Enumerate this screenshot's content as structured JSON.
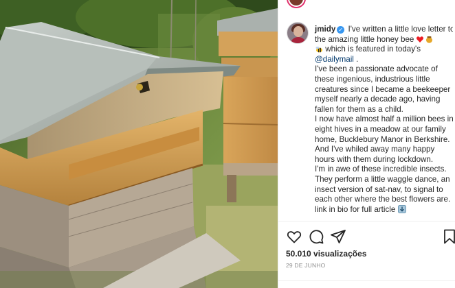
{
  "post": {
    "username": "jmidy",
    "caption_intro_a": " I've written a little love letter to the amazing little honey bee ",
    "caption_intro_b": " which is featured in today's ",
    "mention": "@dailymail",
    "mention_after": " .",
    "paragraph_1": "I've been a passionate advocate of these ingenious, industrious little creatures since I became a beekeeper myself nearly a decade ago, having fallen for them as a child.",
    "paragraph_2": "I now have almost half a million bees in eight hives in a meadow at our family home, Bucklebury Manor in Berkshire. And I've whiled away many happy hours with them during lockdown.",
    "paragraph_3": "I'm in awe of these incredible insects. They perform a little waggle dance, an insect version of sat-nav, to signal to each other where the best flowers are.",
    "link_text": "link in bio for full article",
    "views": "50.010 visualizações",
    "date": "29 DE JUNHO"
  },
  "icons": {
    "verified": "verified-badge-icon",
    "like": "heart-icon",
    "comment": "comment-bubble-icon",
    "share": "paper-plane-icon",
    "save": "bookmark-icon",
    "heart_emoji": "red-heart-emoji",
    "honey_emoji": "honey-pot-emoji",
    "bee_emoji": "honeybee-emoji",
    "link_emoji": "down-arrow-emoji"
  },
  "colors": {
    "verified": "#3897f0",
    "mention": "#00376b",
    "text": "#262626",
    "secondary": "#8e8e8e",
    "heart": "#ed1c24",
    "story_ring": "#e1306c"
  }
}
